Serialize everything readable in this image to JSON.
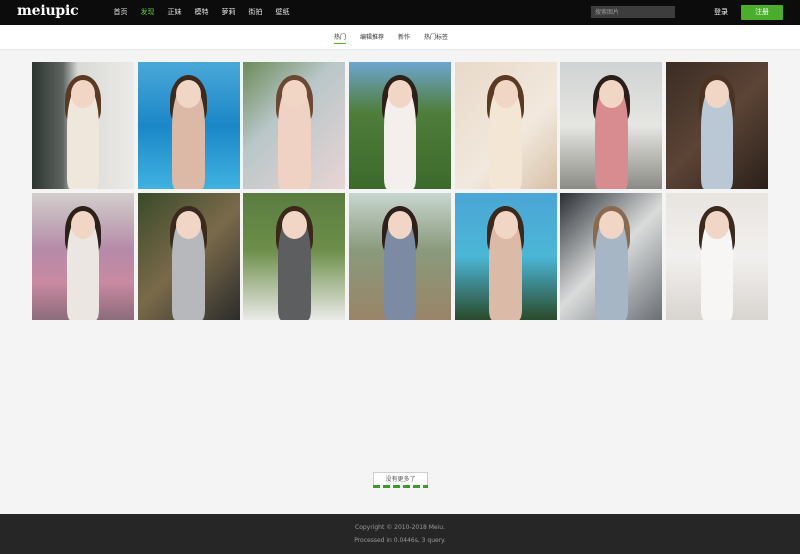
{
  "header": {
    "logo": "meiupic",
    "nav": [
      {
        "label": "首页",
        "active": false
      },
      {
        "label": "发现",
        "active": true
      },
      {
        "label": "正妹",
        "active": false
      },
      {
        "label": "模特",
        "active": false
      },
      {
        "label": "萝莉",
        "active": false
      },
      {
        "label": "街拍",
        "active": false
      },
      {
        "label": "壁纸",
        "active": false
      }
    ],
    "search_placeholder": "搜索图片",
    "login_label": "登录",
    "register_label": "注册"
  },
  "tabs": [
    {
      "label": "热门",
      "active": true
    },
    {
      "label": "编辑推荐",
      "active": false
    },
    {
      "label": "新作",
      "active": false
    },
    {
      "label": "热门标签",
      "active": false
    }
  ],
  "photos": [
    {
      "bg": "linear-gradient(90deg,#2d3530 0%,#5d6460 30%,#d9dad6 45%,#eceae6 100%)",
      "figure": "#efe6dc",
      "hair": "#5a3a22"
    },
    {
      "bg": "linear-gradient(180deg,#4aa8d8 0%,#1b87c8 50%,#3fb2e0 100%)",
      "figure": "#dcb9a6",
      "hair": "#3c2a20"
    },
    {
      "bg": "linear-gradient(135deg,#6c8b5a 0%,#b9c7c9 40%,#e8d4d4 100%)",
      "figure": "#f0d2c4",
      "hair": "#6b4834"
    },
    {
      "bg": "linear-gradient(180deg,#6fa5cf 0%,#4f7d3a 40%,#3b6a2c 100%)",
      "figure": "#f4eeec",
      "hair": "#2d2016"
    },
    {
      "bg": "linear-gradient(135deg,#e8d9c9 0%,#f2e9de 60%,#d7c1a8 100%)",
      "figure": "#f3e6d4",
      "hair": "#5b3a24"
    },
    {
      "bg": "linear-gradient(180deg,#cfd3d3 0%,#e6e6e2 50%,#8a8c85 100%)",
      "figure": "#d88c90",
      "hair": "#2a1e18"
    },
    {
      "bg": "linear-gradient(135deg,#3a2c24 0%,#5c4436 50%,#2a201a 100%)",
      "figure": "#b9c8d4",
      "hair": "#4b3222"
    },
    {
      "bg": "linear-gradient(180deg,#d2cfcc 0%,#b58aa8 45%,#c98aa2 70%,#8c6c7a 100%)",
      "figure": "#ece6e2",
      "hair": "#2c2018"
    },
    {
      "bg": "linear-gradient(135deg,#3a4a2a 0%,#7a6a4a 50%,#2c2c2c 100%)",
      "figure": "#b6b8bc",
      "hair": "#3a2a1e"
    },
    {
      "bg": "linear-gradient(180deg,#5a7c40 0%,#6d8f4a 45%,#eaeae8 100%)",
      "figure": "#5c5e60",
      "hair": "#3a2818"
    },
    {
      "bg": "linear-gradient(180deg,#c8d6d0 0%,#8a9a7c 45%,#9a8468 100%)",
      "figure": "#7c8aa4",
      "hair": "#2c2018"
    },
    {
      "bg": "linear-gradient(180deg,#4ba6d6 0%,#4bb6d6 50%,#2a4a2a 100%)",
      "figure": "#dcbaa8",
      "hair": "#3a2a1e"
    },
    {
      "bg": "linear-gradient(135deg,#2a2e34 0%,#dadcdc 50%,#6a6e74 100%)",
      "figure": "#a6b6c4",
      "hair": "#8a6a4e"
    },
    {
      "bg": "linear-gradient(180deg,#e8e4e0 0%,#f2f0ee 50%,#d8d4d0 100%)",
      "figure": "#f8f6f4",
      "hair": "#3a2a1e"
    }
  ],
  "load_more_label": "没有更多了",
  "footer": {
    "copyright": "Copyright © 2010-2018 Meiu.",
    "processed": "Processed in 0.0446s, 3 query."
  }
}
